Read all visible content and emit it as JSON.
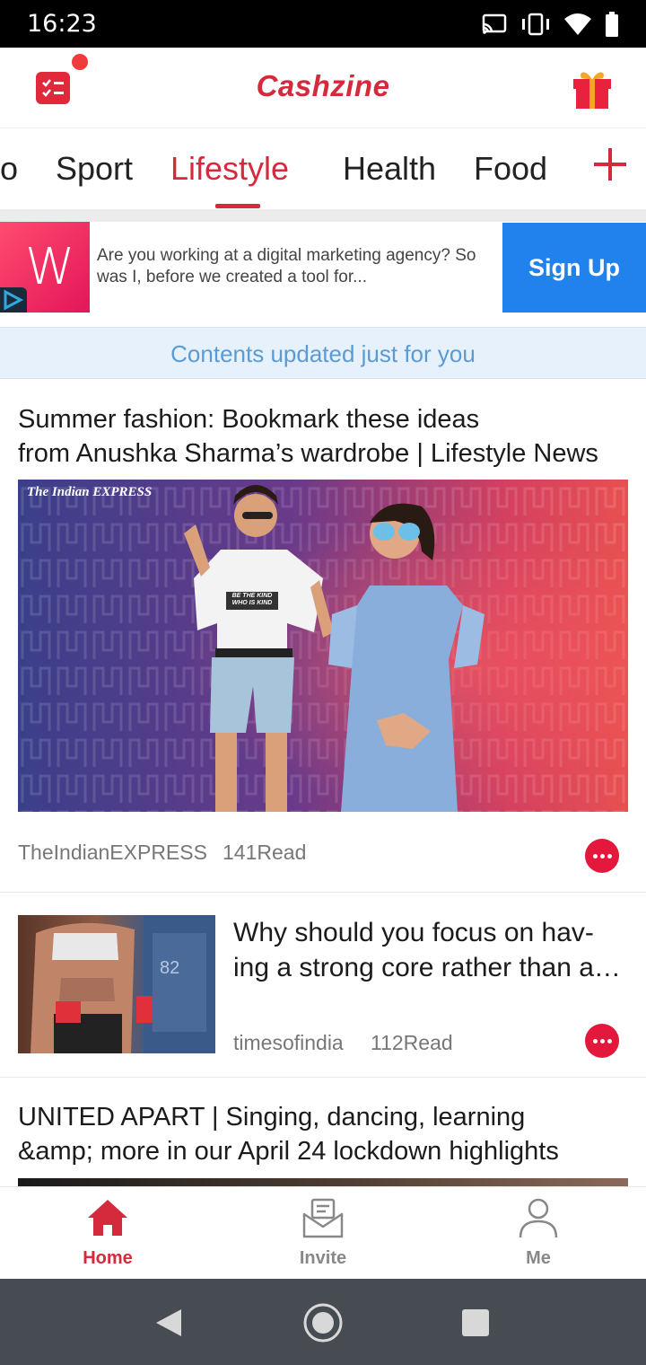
{
  "status_bar": {
    "time": "16:23",
    "icons": [
      "cast-icon",
      "vibrate-icon",
      "wifi-icon",
      "battery-icon"
    ]
  },
  "header": {
    "brand": "Cashzine",
    "left_icon": "tasks-icon",
    "right_icon": "gift-icon",
    "brand_color": "#d42a3c"
  },
  "categories": {
    "tabs": [
      "o",
      "Sport",
      "Lifestyle",
      "Health",
      "Food"
    ],
    "active": "Lifestyle",
    "add_icon": "plus-icon"
  },
  "ad": {
    "logo_letter": "W",
    "text": "Are you working at a digital marketing agency? So was I, before we created a tool for...",
    "cta": "Sign Up",
    "cta_color": "#2182ee"
  },
  "feed": {
    "updated_notice": "Contents updated just for you",
    "articles": [
      {
        "title_line1": "Summer fashion: Bookmark these ideas",
        "title_line2": "from Anushka Sharma’s wardrobe | Lifestyle News",
        "image_caption": "The Indian EXPRESS",
        "shirt_text": "BE THE KIND WHO IS KIND",
        "source": "TheIndianEXPRESS",
        "reads": "141Read"
      },
      {
        "title_line1": "Why should you focus on hav-",
        "title_line2": "ing a strong core rather than abs?",
        "thumb_text": "82",
        "source": "timesofindia",
        "reads": "112Read"
      },
      {
        "title_line1": "UNITED APART | Singing, dancing, learning",
        "title_line2": "&amp; more in our April 24 lockdown highlights"
      }
    ]
  },
  "bottom_nav": {
    "items": [
      {
        "label": "Home",
        "icon": "home-icon",
        "active": true
      },
      {
        "label": "Invite",
        "icon": "invite-mail-icon",
        "active": false
      },
      {
        "label": "Me",
        "icon": "profile-icon",
        "active": false
      }
    ]
  },
  "system_nav": [
    "back-icon",
    "home-circle-icon",
    "recents-icon"
  ]
}
